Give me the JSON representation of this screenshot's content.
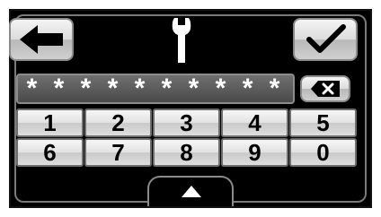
{
  "header": {
    "back_icon": "left-arrow-icon",
    "title_icon": "wrench-icon",
    "confirm_icon": "checkmark-icon"
  },
  "password": {
    "masked_value": "* * * * * * * * * *",
    "delete_icon": "backspace-x-icon"
  },
  "keypad": {
    "rows": [
      [
        "1",
        "2",
        "3",
        "4",
        "5"
      ],
      [
        "6",
        "7",
        "8",
        "9",
        "0"
      ]
    ]
  },
  "footer": {
    "expand_icon": "triangle-up-icon"
  },
  "colors": {
    "background": "#000000",
    "button_light": "#f4f4f4",
    "button_dark": "#b9b9b9",
    "password_field": "#5a5a5a"
  }
}
